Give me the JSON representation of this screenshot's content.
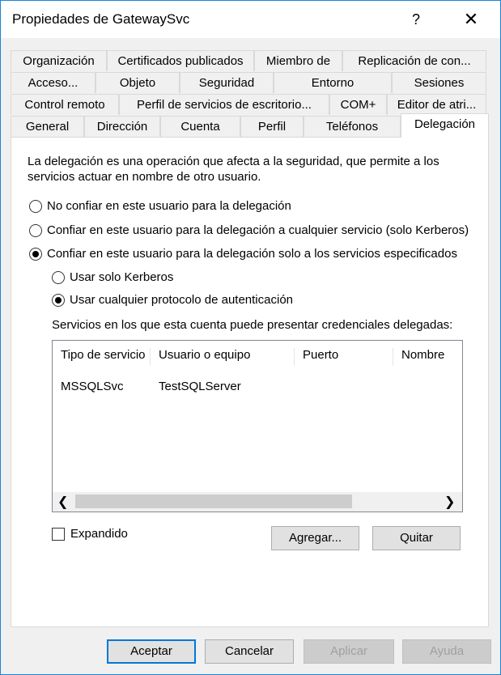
{
  "window": {
    "title": "Propiedades de GatewaySvc",
    "help": "?",
    "close": "✕"
  },
  "tabs": {
    "row1": [
      "Organización",
      "Certificados publicados",
      "Miembro de",
      "Replicación de con..."
    ],
    "row2": [
      "Acceso...",
      "Objeto",
      "Seguridad",
      "Entorno",
      "Sesiones"
    ],
    "row3": [
      "Control remoto",
      "Perfil de servicios de escritorio...",
      "COM+",
      "Editor de atri..."
    ],
    "row4": [
      "General",
      "Dirección",
      "Cuenta",
      "Perfil",
      "Teléfonos",
      "Delegación"
    ],
    "active": "Delegación"
  },
  "delegation": {
    "description": "La delegación es una operación que afecta a la seguridad, que permite a los servicios actuar en nombre de otro usuario.",
    "options": [
      {
        "label": "No confiar en este usuario para la delegación",
        "checked": false
      },
      {
        "label": "Confiar en este usuario para la delegación a cualquier servicio (solo Kerberos)",
        "checked": false
      },
      {
        "label": "Confiar en este usuario para la delegación solo a los servicios especificados",
        "checked": true
      }
    ],
    "sub_options": [
      {
        "label": "Usar solo Kerberos",
        "checked": false
      },
      {
        "label": "Usar cualquier protocolo de autenticación",
        "checked": true
      }
    ],
    "services_label": "Servicios en los que esta cuenta puede presentar credenciales delegadas:",
    "columns": [
      "Tipo de servicio",
      "Usuario o equipo",
      "Puerto",
      "Nombre"
    ],
    "rows": [
      [
        "MSSQLSvc",
        "TestSQLServer",
        "",
        ""
      ]
    ],
    "expand_label": "Expandido",
    "expand_checked": false,
    "add_button": "Agregar...",
    "remove_button": "Quitar"
  },
  "footer": {
    "ok": "Aceptar",
    "cancel": "Cancelar",
    "apply": "Aplicar",
    "help": "Ayuda"
  }
}
